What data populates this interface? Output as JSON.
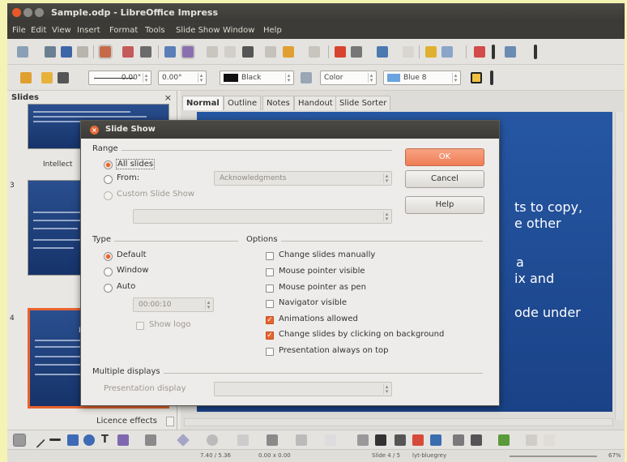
{
  "window": {
    "title": "Sample.odp - LibreOffice Impress"
  },
  "menu": [
    "File",
    "Edit",
    "View",
    "Insert",
    "Format",
    "Tools",
    "Slide Show",
    "Window",
    "Help"
  ],
  "line_toolbar": {
    "size_value": "0.00\"",
    "angle_value": "0.00°",
    "line_color": "Black",
    "fill_mode": "Color",
    "fill_color": "Blue 8"
  },
  "slides_pane": {
    "title": "Slides",
    "slide2_label": "Intellect",
    "slide3_number": "3",
    "slide4_number": "4",
    "slide5_label": "Licence effects",
    "slide4_heading": "L"
  },
  "view_tabs": [
    "Normal",
    "Outline",
    "Notes",
    "Handout",
    "Slide Sorter"
  ],
  "slide_text": {
    "line1": "ts to copy,",
    "line2": "e other",
    "line3": "a",
    "line4": "ix and",
    "line5": "ode under"
  },
  "dialog": {
    "title": "Slide Show",
    "range": {
      "heading": "Range",
      "all_slides": "All slides",
      "from": "From:",
      "from_value": "Acknowledgments",
      "custom": "Custom Slide Show"
    },
    "type": {
      "heading": "Type",
      "default": "Default",
      "window": "Window",
      "auto": "Auto",
      "time": "00:00:10",
      "show_logo": "Show logo"
    },
    "options": {
      "heading": "Options",
      "items": [
        {
          "label": "Change slides manually",
          "checked": false
        },
        {
          "label": "Mouse pointer visible",
          "checked": false
        },
        {
          "label": "Mouse pointer as pen",
          "checked": false
        },
        {
          "label": "Navigator visible",
          "checked": false
        },
        {
          "label": "Animations allowed",
          "checked": true
        },
        {
          "label": "Change slides by clicking on background",
          "checked": true
        },
        {
          "label": "Presentation always on top",
          "checked": false
        }
      ]
    },
    "multiple_displays": {
      "heading": "Multiple displays",
      "presentation_display": "Presentation display"
    },
    "buttons": {
      "ok": "OK",
      "cancel": "Cancel",
      "help": "Help"
    }
  },
  "status": {
    "position": "7.40 / 5.36",
    "size": "0.00 x 0.00",
    "slide": "Slide 4 / 5",
    "layout": "lyt-bluegrey",
    "zoom": "67%"
  },
  "colors": {
    "accent": "#e8632e",
    "slide_blue": "#1f4a94",
    "titlebar": "#3c3b37"
  }
}
